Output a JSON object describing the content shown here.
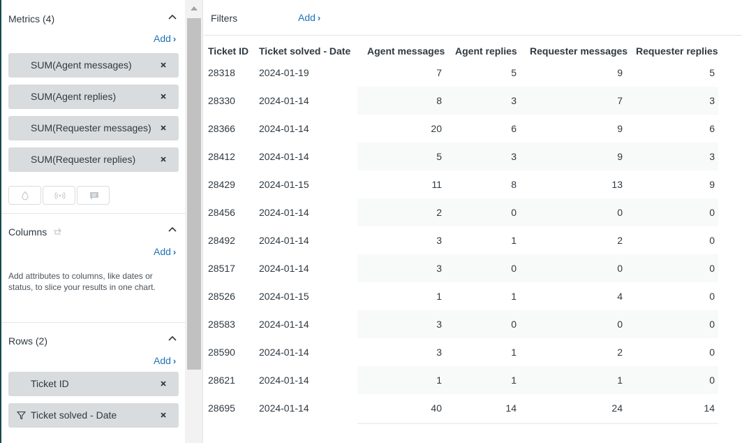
{
  "left_panel": {
    "metrics": {
      "title": "Metrics (4)",
      "add_label": "Add",
      "items": [
        "SUM(Agent messages)",
        "SUM(Agent replies)",
        "SUM(Requester messages)",
        "SUM(Requester replies)"
      ],
      "tools": [
        "droplet-icon",
        "broadcast-icon",
        "comment-icon"
      ]
    },
    "columns": {
      "title": "Columns",
      "add_label": "Add",
      "help": "Add attributes to columns, like dates or status, to slice your results in one chart."
    },
    "rows": {
      "title": "Rows (2)",
      "add_label": "Add",
      "items": [
        "Ticket ID",
        "Ticket solved - Date"
      ]
    }
  },
  "filters": {
    "label": "Filters",
    "add_label": "Add"
  },
  "table": {
    "headers": [
      "Ticket ID",
      "Ticket solved - Date",
      "Agent messages",
      "Agent replies",
      "Requester messages",
      "Requester replies"
    ],
    "rows": [
      [
        "28318",
        "2024-01-19",
        "7",
        "5",
        "9",
        "5"
      ],
      [
        "28330",
        "2024-01-14",
        "8",
        "3",
        "7",
        "3"
      ],
      [
        "28366",
        "2024-01-14",
        "20",
        "6",
        "9",
        "6"
      ],
      [
        "28412",
        "2024-01-14",
        "5",
        "3",
        "9",
        "3"
      ],
      [
        "28429",
        "2024-01-15",
        "11",
        "8",
        "13",
        "9"
      ],
      [
        "28456",
        "2024-01-14",
        "2",
        "0",
        "0",
        "0"
      ],
      [
        "28492",
        "2024-01-14",
        "3",
        "1",
        "2",
        "0"
      ],
      [
        "28517",
        "2024-01-14",
        "3",
        "0",
        "0",
        "0"
      ],
      [
        "28526",
        "2024-01-15",
        "1",
        "1",
        "4",
        "0"
      ],
      [
        "28583",
        "2024-01-14",
        "3",
        "0",
        "0",
        "0"
      ],
      [
        "28590",
        "2024-01-14",
        "3",
        "1",
        "2",
        "0"
      ],
      [
        "28621",
        "2024-01-14",
        "1",
        "1",
        "1",
        "0"
      ],
      [
        "28695",
        "2024-01-14",
        "40",
        "14",
        "24",
        "14"
      ]
    ]
  }
}
